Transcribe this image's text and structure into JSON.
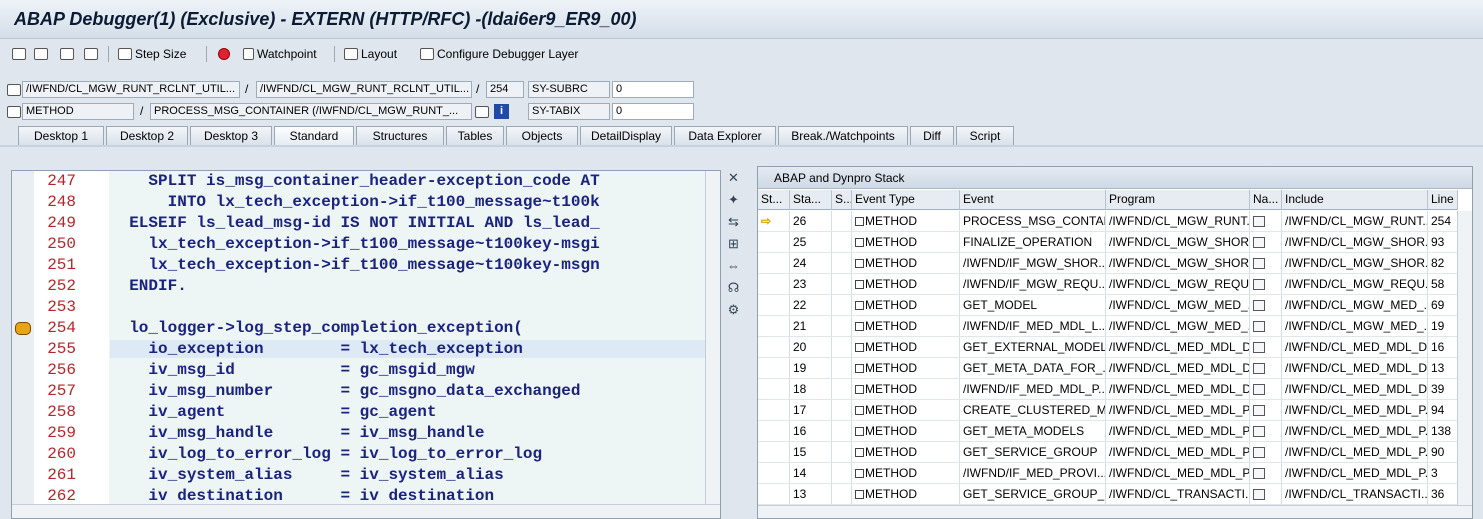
{
  "window": {
    "title": "ABAP Debugger(1)  (Exclusive) - EXTERN (HTTP/RFC) -(ldai6er9_ER9_00)"
  },
  "toolbar": {
    "step_size": "Step Size",
    "watchpoint": "Watchpoint",
    "layout": "Layout",
    "configure": "Configure Debugger Layer"
  },
  "info": {
    "program": "/IWFND/CL_MGW_RUNT_RCLNT_UTIL...",
    "include": "/IWFND/CL_MGW_RUNT_RCLNT_UTIL...",
    "line": "254",
    "type": "METHOD",
    "method": "PROCESS_MSG_CONTAINER (/IWFND/CL_MGW_RUNT_...",
    "sy1_name": "SY-SUBRC",
    "sy1_value": "0",
    "sy2_name": "SY-TABIX",
    "sy2_value": "0"
  },
  "tabs": [
    "Desktop 1",
    "Desktop 2",
    "Desktop 3",
    "Standard",
    "Structures",
    "Tables",
    "Objects",
    "DetailDisplay",
    "Data Explorer",
    "Break./Watchpoints",
    "Diff",
    "Script"
  ],
  "active_tab": "Standard",
  "code": [
    {
      "n": "247",
      "t": "    SPLIT is_msg_container_header-exception_code AT"
    },
    {
      "n": "248",
      "t": "      INTO lx_tech_exception->if_t100_message~t100k"
    },
    {
      "n": "249",
      "t": "  ELSEIF ls_lead_msg-id IS NOT INITIAL AND ls_lead_"
    },
    {
      "n": "250",
      "t": "    lx_tech_exception->if_t100_message~t100key-msgi"
    },
    {
      "n": "251",
      "t": "    lx_tech_exception->if_t100_message~t100key-msgn"
    },
    {
      "n": "252",
      "t": "  ENDIF."
    },
    {
      "n": "253",
      "t": ""
    },
    {
      "n": "254",
      "t": "  lo_logger->log_step_completion_exception("
    },
    {
      "n": "255",
      "t": "    io_exception        = lx_tech_exception"
    },
    {
      "n": "256",
      "t": "    iv_msg_id           = gc_msgid_mgw"
    },
    {
      "n": "257",
      "t": "    iv_msg_number       = gc_msgno_data_exchanged"
    },
    {
      "n": "258",
      "t": "    iv_agent            = gc_agent"
    },
    {
      "n": "259",
      "t": "    iv_msg_handle       = iv_msg_handle"
    },
    {
      "n": "260",
      "t": "    iv_log_to_error_log = iv_log_to_error_log"
    },
    {
      "n": "261",
      "t": "    iv_system_alias     = iv_system_alias"
    },
    {
      "n": "262",
      "t": "    iv destination      = iv destination"
    }
  ],
  "stack": {
    "title": "ABAP and Dynpro Stack",
    "columns": [
      "St...",
      "Sta...",
      "S...",
      "Event Type",
      "Event",
      "Program",
      "Na...",
      "Include",
      "Line"
    ],
    "rows": [
      {
        "sta": "26",
        "type": "METHOD",
        "event": "PROCESS_MSG_CONTAI...",
        "program": "/IWFND/CL_MGW_RUNT...",
        "include": "/IWFND/CL_MGW_RUNT...",
        "line": "254",
        "current": true
      },
      {
        "sta": "25",
        "type": "METHOD",
        "event": "FINALIZE_OPERATION",
        "program": "/IWFND/CL_MGW_SHOR...",
        "include": "/IWFND/CL_MGW_SHOR...",
        "line": "93"
      },
      {
        "sta": "24",
        "type": "METHOD",
        "event": "/IWFND/IF_MGW_SHOR...",
        "program": "/IWFND/CL_MGW_SHOR...",
        "include": "/IWFND/CL_MGW_SHOR...",
        "line": "82"
      },
      {
        "sta": "23",
        "type": "METHOD",
        "event": "/IWFND/IF_MGW_REQU...",
        "program": "/IWFND/CL_MGW_REQU...",
        "include": "/IWFND/CL_MGW_REQU...",
        "line": "58"
      },
      {
        "sta": "22",
        "type": "METHOD",
        "event": "GET_MODEL",
        "program": "/IWFND/CL_MGW_MED_...",
        "include": "/IWFND/CL_MGW_MED_...",
        "line": "69"
      },
      {
        "sta": "21",
        "type": "METHOD",
        "event": "/IWFND/IF_MED_MDL_L...",
        "program": "/IWFND/CL_MGW_MED_...",
        "include": "/IWFND/CL_MGW_MED_...",
        "line": "19"
      },
      {
        "sta": "20",
        "type": "METHOD",
        "event": "GET_EXTERNAL_MODEL",
        "program": "/IWFND/CL_MED_MDL_D...",
        "include": "/IWFND/CL_MED_MDL_D...",
        "line": "16"
      },
      {
        "sta": "19",
        "type": "METHOD",
        "event": "GET_META_DATA_FOR_...",
        "program": "/IWFND/CL_MED_MDL_D...",
        "include": "/IWFND/CL_MED_MDL_D...",
        "line": "13"
      },
      {
        "sta": "18",
        "type": "METHOD",
        "event": "/IWFND/IF_MED_MDL_P...",
        "program": "/IWFND/CL_MED_MDL_D...",
        "include": "/IWFND/CL_MED_MDL_D...",
        "line": "39"
      },
      {
        "sta": "17",
        "type": "METHOD",
        "event": "CREATE_CLUSTERED_M...",
        "program": "/IWFND/CL_MED_MDL_P...",
        "include": "/IWFND/CL_MED_MDL_P...",
        "line": "94"
      },
      {
        "sta": "16",
        "type": "METHOD",
        "event": "GET_META_MODELS",
        "program": "/IWFND/CL_MED_MDL_P...",
        "include": "/IWFND/CL_MED_MDL_P...",
        "line": "138"
      },
      {
        "sta": "15",
        "type": "METHOD",
        "event": "GET_SERVICE_GROUP",
        "program": "/IWFND/CL_MED_MDL_P...",
        "include": "/IWFND/CL_MED_MDL_P...",
        "line": "90"
      },
      {
        "sta": "14",
        "type": "METHOD",
        "event": "/IWFND/IF_MED_PROVI...",
        "program": "/IWFND/CL_MED_MDL_P...",
        "include": "/IWFND/CL_MED_MDL_P...",
        "line": "3"
      },
      {
        "sta": "13",
        "type": "METHOD",
        "event": "GET_SERVICE_GROUP_...",
        "program": "/IWFND/CL_TRANSACTI...",
        "include": "/IWFND/CL_TRANSACTI...",
        "line": "36"
      }
    ]
  }
}
